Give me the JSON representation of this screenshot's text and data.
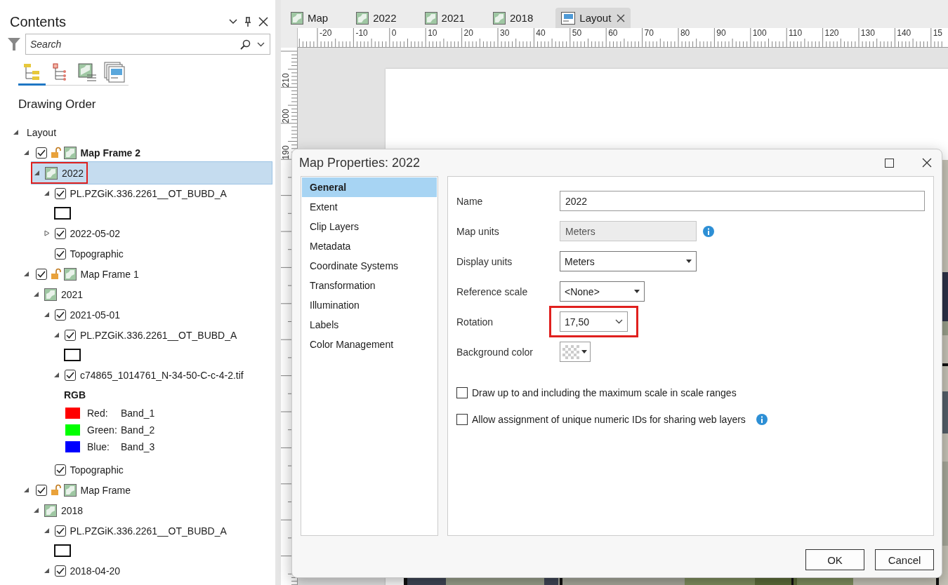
{
  "contents": {
    "title": "Contents",
    "search": {
      "placeholder": "Search"
    },
    "view_tabs": [
      {
        "kind": "order",
        "selected": true
      },
      {
        "kind": "source",
        "selected": false
      },
      {
        "kind": "selection",
        "selected": false
      },
      {
        "kind": "snapping",
        "selected": false
      }
    ],
    "heading": "Drawing Order",
    "tree": [
      {
        "label": "Layout",
        "kind": "layout",
        "expanded": true,
        "selected": false,
        "children": [
          {
            "label": "Map Frame 2",
            "kind": "frame",
            "expanded": true,
            "checked": true,
            "active": true,
            "selected": false,
            "children": [
              {
                "label": "2022",
                "kind": "map",
                "expanded": true,
                "selected": true,
                "annotated": true,
                "children": [
                  {
                    "label": "PL.PZGiK.336.2261__OT_BUBD_A",
                    "kind": "layer",
                    "expanded": true,
                    "checked": true,
                    "selected": false,
                    "symbol": {
                      "kind": "outline"
                    }
                  },
                  {
                    "label": "2022-05-02",
                    "kind": "layer",
                    "expanded": false,
                    "checked": true,
                    "selected": false
                  },
                  {
                    "label": "Topographic",
                    "kind": "layer",
                    "checked": true,
                    "selected": false
                  }
                ]
              }
            ]
          },
          {
            "label": "Map Frame 1",
            "kind": "frame",
            "expanded": true,
            "checked": true,
            "active": false,
            "selected": false,
            "children": [
              {
                "label": "2021",
                "kind": "map",
                "expanded": true,
                "selected": false,
                "children": [
                  {
                    "label": "2021-05-01",
                    "kind": "layer",
                    "expanded": true,
                    "checked": true,
                    "selected": false,
                    "children": [
                      {
                        "label": "PL.PZGiK.336.2261__OT_BUBD_A",
                        "kind": "layer",
                        "expanded": true,
                        "checked": true,
                        "selected": false,
                        "symbol": {
                          "kind": "outline"
                        }
                      },
                      {
                        "label": "c74865_1014761_N-34-50-C-c-4-2.tif",
                        "kind": "layer",
                        "expanded": true,
                        "checked": true,
                        "selected": false,
                        "symbol": {
                          "kind": "rgb",
                          "heading": "RGB",
                          "bands": [
                            {
                              "name": "Red:",
                              "value": "Band_1",
                              "color": "#ff0000"
                            },
                            {
                              "name": "Green:",
                              "value": "Band_2",
                              "color": "#00ff00"
                            },
                            {
                              "name": "Blue:",
                              "value": "Band_3",
                              "color": "#0000ff"
                            }
                          ]
                        }
                      }
                    ]
                  },
                  {
                    "label": "Topographic",
                    "kind": "layer",
                    "checked": true,
                    "selected": false
                  }
                ]
              }
            ]
          },
          {
            "label": "Map Frame",
            "kind": "frame",
            "expanded": true,
            "checked": true,
            "active": false,
            "selected": false,
            "children": [
              {
                "label": "2018",
                "kind": "map",
                "expanded": true,
                "selected": false,
                "children": [
                  {
                    "label": "PL.PZGiK.336.2261__OT_BUBD_A",
                    "kind": "layer",
                    "expanded": true,
                    "checked": true,
                    "selected": false,
                    "symbol": {
                      "kind": "outline"
                    }
                  },
                  {
                    "label": "2018-04-20",
                    "kind": "layer",
                    "expanded": true,
                    "checked": true,
                    "selected": false
                  }
                ]
              }
            ]
          }
        ]
      }
    ]
  },
  "doc_tabs": [
    {
      "label": "Map",
      "kind": "map",
      "selected": false
    },
    {
      "label": "2022",
      "kind": "map",
      "selected": false
    },
    {
      "label": "2021",
      "kind": "map",
      "selected": false
    },
    {
      "label": "2018",
      "kind": "map",
      "selected": false
    },
    {
      "label": "Layout",
      "kind": "layout",
      "selected": true
    }
  ],
  "ruler": {
    "horizontal": [
      "-20",
      "-10",
      "0",
      "10",
      "20",
      "30",
      "40",
      "50",
      "60",
      "70",
      "80",
      "90",
      "100",
      "110",
      "120",
      "130",
      "140",
      "15"
    ],
    "vertical": [
      "210",
      "200",
      "190"
    ]
  },
  "dialog": {
    "title": "Map Properties: 2022",
    "pages": [
      {
        "label": "General",
        "selected": true
      },
      {
        "label": "Extent",
        "selected": false
      },
      {
        "label": "Clip Layers",
        "selected": false
      },
      {
        "label": "Metadata",
        "selected": false
      },
      {
        "label": "Coordinate Systems",
        "selected": false
      },
      {
        "label": "Transformation",
        "selected": false
      },
      {
        "label": "Illumination",
        "selected": false
      },
      {
        "label": "Labels",
        "selected": false
      },
      {
        "label": "Color Management",
        "selected": false
      }
    ],
    "fields": [
      {
        "label": "Name",
        "kind": "text",
        "value": "2022"
      },
      {
        "label": "Map units",
        "kind": "text",
        "value": "Meters",
        "disabled": true,
        "info": true
      },
      {
        "label": "Display units",
        "kind": "select",
        "value": "Meters"
      },
      {
        "label": "Reference scale",
        "kind": "select",
        "value": "<None>"
      },
      {
        "label": "Rotation",
        "kind": "combo",
        "value": "17,50",
        "annotated": true
      },
      {
        "label": "Background color",
        "kind": "color"
      }
    ],
    "options": [
      {
        "label": "Draw up to and including the maximum scale in scale ranges",
        "checked": false
      },
      {
        "label": "Allow assignment of unique numeric IDs for sharing web layers",
        "checked": false,
        "info": true
      }
    ],
    "buttons": [
      "OK",
      "Cancel"
    ]
  }
}
